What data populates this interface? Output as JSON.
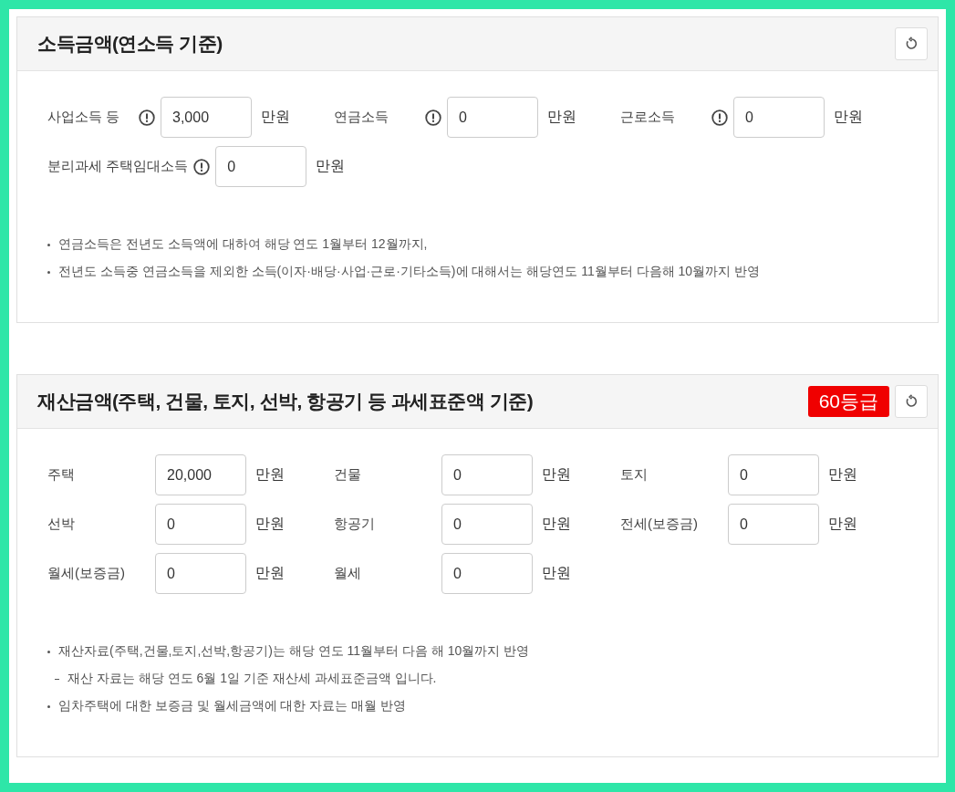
{
  "sections": [
    {
      "title": "소득금액(연소득 기준)",
      "fields": [
        {
          "label": "사업소득 등",
          "info": true,
          "value": "3,000",
          "unit": "만원"
        },
        {
          "label": "연금소득",
          "info": true,
          "value": "0",
          "unit": "만원"
        },
        {
          "label": "근로소득",
          "info": true,
          "value": "0",
          "unit": "만원"
        },
        {
          "label": "분리과세 주택임대소득",
          "info": true,
          "value": "0",
          "unit": "만원"
        }
      ],
      "notes": [
        {
          "kind": "bullet",
          "text": "연금소득은 전년도 소득액에 대하여 해당 연도 1월부터 12월까지,"
        },
        {
          "kind": "bullet",
          "text": "전년도 소득중 연금소득을 제외한 소득(이자·배당·사업·근로·기타소득)에 대해서는 해당연도 11월부터 다음해 10월까지 반영"
        }
      ]
    },
    {
      "title": "재산금액(주택, 건물, 토지, 선박, 항공기 등 과세표준액 기준)",
      "badge": "60등급",
      "fields": [
        {
          "label": "주택",
          "info": false,
          "value": "20,000",
          "unit": "만원"
        },
        {
          "label": "건물",
          "info": false,
          "value": "0",
          "unit": "만원"
        },
        {
          "label": "토지",
          "info": false,
          "value": "0",
          "unit": "만원"
        },
        {
          "label": "선박",
          "info": false,
          "value": "0",
          "unit": "만원"
        },
        {
          "label": "항공기",
          "info": false,
          "value": "0",
          "unit": "만원"
        },
        {
          "label": "전세(보증금)",
          "info": false,
          "value": "0",
          "unit": "만원"
        },
        {
          "label": "월세(보증금)",
          "info": false,
          "value": "0",
          "unit": "만원"
        },
        {
          "label": "월세",
          "info": false,
          "value": "0",
          "unit": "만원"
        }
      ],
      "notes": [
        {
          "kind": "bullet",
          "text": "재산자료(주택,건물,토지,선박,항공기)는 해당 연도 11월부터 다음 해 10월까지 반영"
        },
        {
          "kind": "sub",
          "text": "재산 자료는 해당 연도 6월 1일 기준 재산세 과세표준금액 입니다."
        },
        {
          "kind": "bullet",
          "text": "임차주택에 대한 보증금 및 월세금액에 대한 자료는 매월 반영"
        }
      ]
    }
  ]
}
